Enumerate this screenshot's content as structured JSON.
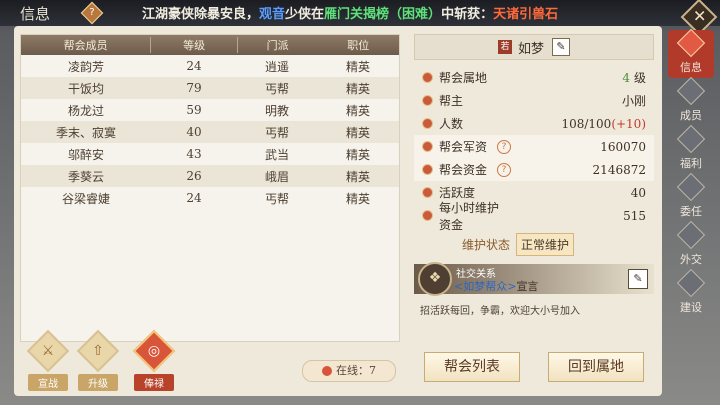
{
  "topbar": {
    "title": "信息",
    "help_icon": "?",
    "marquee": {
      "p1": "江湖豪侠除暴安良，",
      "p2": "观音",
      "p3": "少侠在",
      "p4": "雁门关揭榜（困难）",
      "p5": "中斩获：",
      "p6": "天诸引兽石"
    }
  },
  "table": {
    "headers": [
      "帮会成员",
      "等级",
      "门派",
      "职位"
    ],
    "rows": [
      [
        "凌韵芳",
        "24",
        "逍遥",
        "精英"
      ],
      [
        "干饭均",
        "79",
        "丐帮",
        "精英"
      ],
      [
        "杨龙过",
        "59",
        "明教",
        "精英"
      ],
      [
        "季末、寂寞",
        "40",
        "丐帮",
        "精英"
      ],
      [
        "邬醉安",
        "43",
        "武当",
        "精英"
      ],
      [
        "季葵云",
        "26",
        "峨眉",
        "精英"
      ],
      [
        "谷梁睿婕",
        "24",
        "丐帮",
        "精英"
      ]
    ]
  },
  "bottom_buttons": [
    {
      "label": "宣战",
      "icon": "crossed-swords-icon",
      "glyph": "⚔"
    },
    {
      "label": "升级",
      "icon": "upgrade-arrow-icon",
      "glyph": "⇧"
    },
    {
      "label": "俸禄",
      "icon": "coin-icon",
      "glyph": "◎"
    }
  ],
  "online": "在线：7",
  "guild": {
    "rank_badge": "若",
    "name": "如梦",
    "info": [
      {
        "label": "帮会属地",
        "value": "4",
        "suffix": "级"
      },
      {
        "label": "帮主",
        "value": "小刚"
      },
      {
        "label": "人数",
        "value": "108/100",
        "plus": "(+10)"
      },
      {
        "label": "帮会军资",
        "value": "160070"
      },
      {
        "label": "帮会资金",
        "value": "2146872"
      },
      {
        "label": "活跃度",
        "value": "40"
      },
      {
        "label": "每小时维护资金",
        "value": "515"
      }
    ],
    "maintenance_label": "维护状态",
    "maintenance_status": "正常维护",
    "social_title": "社交关系",
    "social_link": "<如梦帮众>",
    "social_action": "宣言",
    "announcement": "招活跃每回，争霸，欢迎大小号加入"
  },
  "actions": {
    "guild_list": "帮会列表",
    "return_home": "回到属地"
  },
  "side_tabs": [
    "信息",
    "成员",
    "福利",
    "委任",
    "外交",
    "建设"
  ],
  "colors": {
    "accent_red": "#b23a2a",
    "paper": "#efe9dc"
  }
}
